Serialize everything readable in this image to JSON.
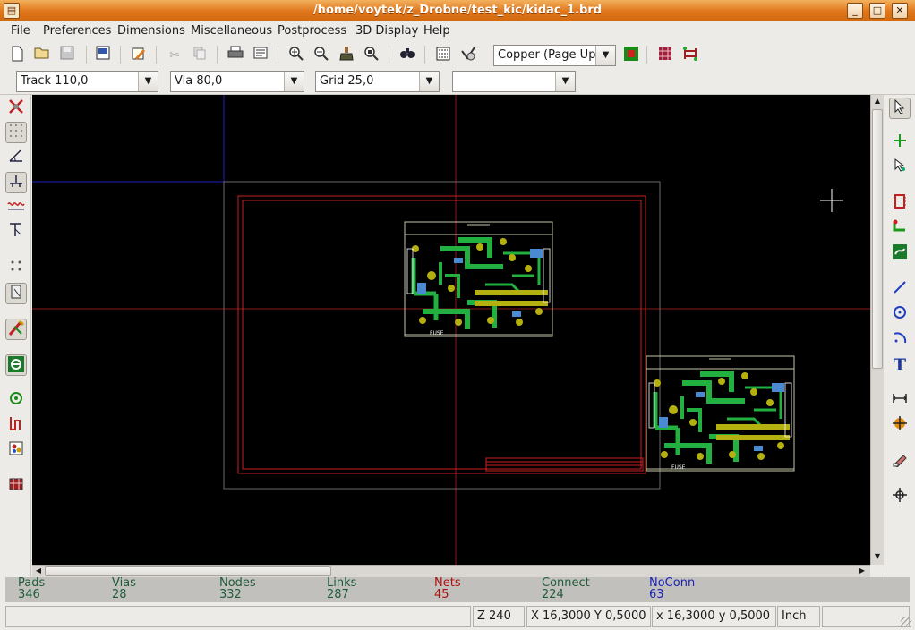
{
  "window": {
    "title": "/home/voytek/z_Drobne/test_kic/kidac_1.brd",
    "minimize_label": "_",
    "maximize_label": "□",
    "close_label": "✕"
  },
  "menu": {
    "items": [
      "File",
      "Preferences",
      "Dimensions",
      "Miscellaneous",
      "Postprocess",
      "3D Display",
      "Help"
    ]
  },
  "toolbar": {
    "layer_select": "Copper     (Page Up)"
  },
  "toolbar2": {
    "track": "Track 110,0",
    "via": "Via 80,0",
    "grid": "Grid 25,0",
    "extra": ""
  },
  "icons": {
    "top": [
      "new-board-icon",
      "open-board-icon",
      "save-board-icon",
      "page-settings-icon",
      "module-editor-icon",
      "cut-icon",
      "copy-icon",
      "print-icon",
      "plot-icon",
      "zoom-in-icon",
      "zoom-out-icon",
      "zoom-redraw-icon",
      "zoom-fit-icon",
      "find-icon",
      "netlist-icon",
      "drc-icon",
      "layer-pair-icon",
      "auto-place-icon",
      "auto-route-icon"
    ],
    "left": [
      "drc-off-icon",
      "grid-icon",
      "polar-coords-icon",
      "units-inch-icon",
      "units-mm-icon",
      "cursor-shape-icon",
      "ratsnest-icon",
      "module-ratsnest-icon",
      "auto-delete-track-icon",
      "show-zones-icon",
      "pads-sketch-icon",
      "tracks-sketch-icon",
      "high-contrast-icon",
      "microwave-toolbar-icon"
    ],
    "right": [
      "select-icon",
      "add-modules-icon",
      "add-tracks-icon",
      "net-highlight-icon",
      "local-ratsnest-icon",
      "add-zones-icon",
      "add-graphic-line-icon",
      "add-circle-icon",
      "add-arc-icon",
      "add-text-icon",
      "add-dimension-icon",
      "add-mire-icon",
      "delete-icon",
      "set-origin-icon"
    ]
  },
  "board_labels": {
    "fuse_1": "FUSE",
    "fuse_2": "FUSE"
  },
  "colors": {
    "canvas": "#000000",
    "board_edge": "#c6c6a8",
    "page_frame": "#c82020",
    "copper_track": "#22b040",
    "pad": "#b4b010",
    "silkscreen": "#ffffff",
    "axis": "#8c1a1a",
    "origin_guide": "#2020c0",
    "info_text": "#1f5c3a",
    "nets_text": "#b01010",
    "noconn_text": "#1a22b8",
    "titlebar": "#e0761b"
  },
  "info": {
    "pads_label": "Pads",
    "pads_value": "346",
    "vias_label": "Vias",
    "vias_value": "28",
    "nodes_label": "Nodes",
    "nodes_value": "332",
    "links_label": "Links",
    "links_value": "287",
    "nets_label": "Nets",
    "nets_value": "45",
    "connect_label": "Connect",
    "connect_value": "224",
    "noconn_label": "NoConn",
    "noconn_value": "63"
  },
  "status": {
    "zoom": "Z 240",
    "abs_coords": "X 16,3000  Y 0,5000",
    "rel_coords": "x 16,3000  y 0,5000",
    "units": "Inch"
  }
}
